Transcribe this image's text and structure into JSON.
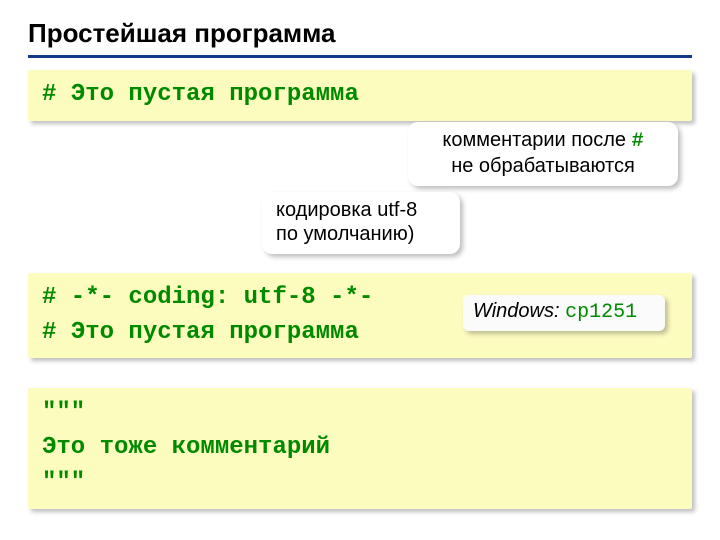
{
  "title": "Простейшая программа",
  "code1": {
    "line1": "# Это пустая программа"
  },
  "callouts": {
    "comments_pre": "комментарии после ",
    "comments_hash": "#",
    "comments_line2": "не обрабатываются",
    "encoding_line1": "кодировка utf-8",
    "encoding_line2": "по умолчанию)",
    "windows_label": "Windows: ",
    "windows_cp": "cp1251"
  },
  "code2": {
    "line1": "# -*- coding: utf-8 -*-",
    "line2": "# Это пустая программа"
  },
  "code3": {
    "line1": "\"\"\"",
    "line2": "Это тоже комментарий",
    "line3": "\"\"\""
  }
}
